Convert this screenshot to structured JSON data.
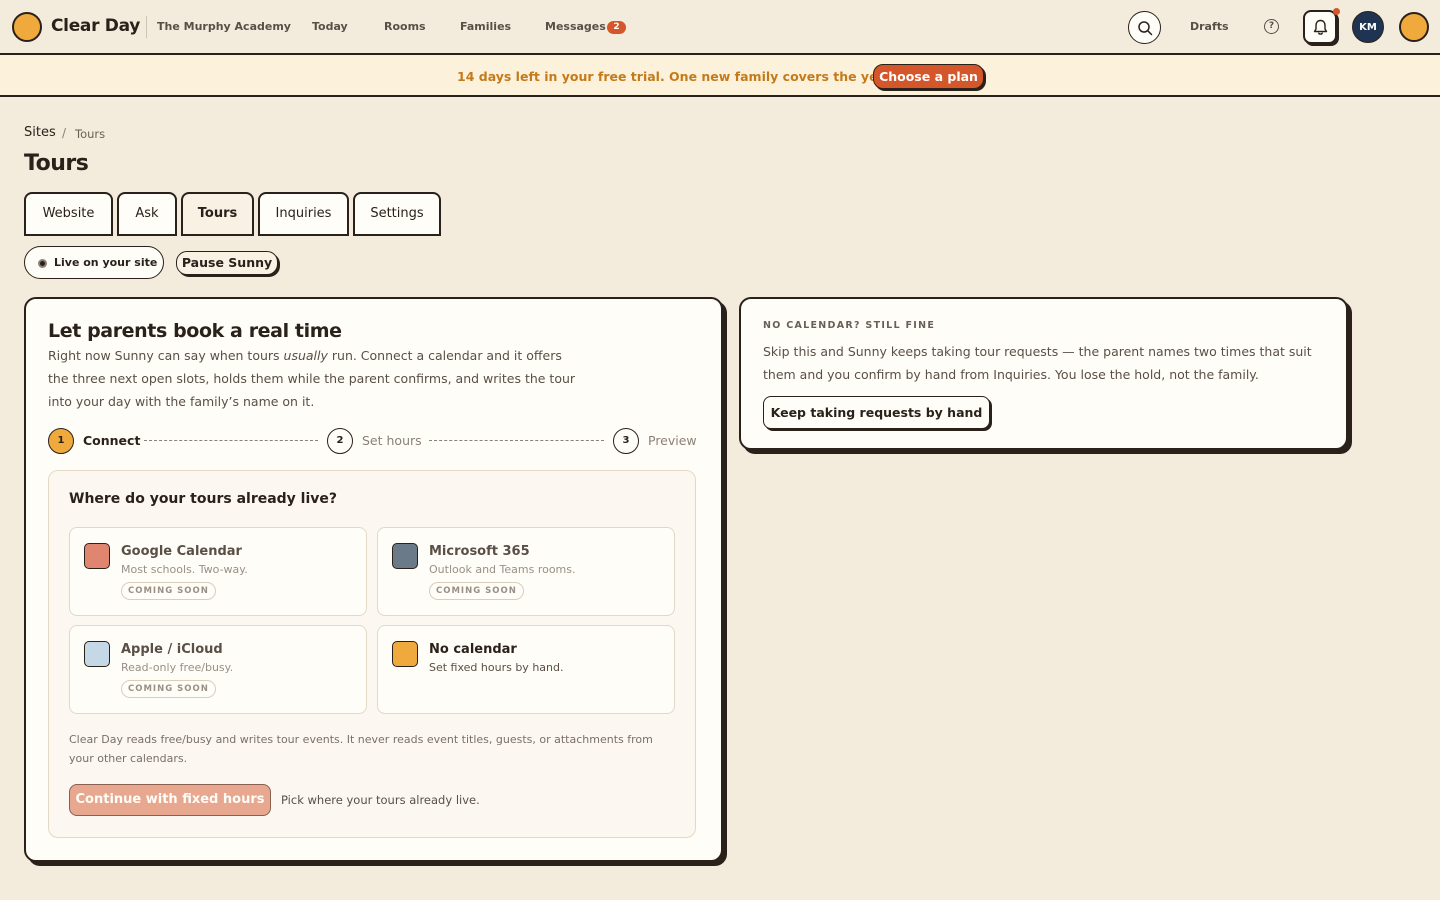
{
  "topnav": {
    "brand": "Clear Day",
    "school": "The Murphy Academy",
    "links": [
      "Today",
      "Rooms",
      "Families",
      "Messages"
    ],
    "messages_count": "2",
    "drafts": "Drafts",
    "help": "?",
    "avatar_initials": "KM"
  },
  "trial": {
    "text": "14 days left in your free trial. One new family covers the year.",
    "button": "Choose a plan"
  },
  "breadcrumb": {
    "root": "Sites",
    "separator": "/",
    "current": "Tours"
  },
  "page_title": "Tours",
  "tabs": [
    {
      "label": "Website"
    },
    {
      "label": "Ask"
    },
    {
      "label": "Tours"
    },
    {
      "label": "Inquiries"
    },
    {
      "label": "Settings"
    }
  ],
  "status": {
    "live_label": "Live on your site",
    "pause_label": "Pause Sunny"
  },
  "main_card": {
    "title": "Let parents book a real time",
    "desc_before": "Right now Sunny can say when tours ",
    "desc_emph": "usually",
    "desc_after": " run. Connect a calendar and it offers the three next open slots, holds them while the parent confirms, and writes the tour into your day with the family’s name on it.",
    "steps": [
      {
        "num": "1",
        "label": "Connect"
      },
      {
        "num": "2",
        "label": "Set hours"
      },
      {
        "num": "3",
        "label": "Preview"
      }
    ],
    "question": "Where do your tours already live?",
    "options": [
      {
        "name": "Google Calendar",
        "sub": "Most schools. Two-way.",
        "badge": "COMING SOON",
        "color": "#e08670"
      },
      {
        "name": "Microsoft 365",
        "sub": "Outlook and Teams rooms.",
        "badge": "COMING SOON",
        "color": "#6b7a88"
      },
      {
        "name": "Apple / iCloud",
        "sub": "Read-only free/busy.",
        "badge": "COMING SOON",
        "color": "#c4d8e6"
      },
      {
        "name": "No calendar",
        "sub": "Set fixed hours by hand.",
        "badge": "",
        "color": "#f0a93c"
      }
    ],
    "fine_print": "Clear Day reads free/busy and writes tour events. It never reads event titles, guests, or attachments from your other calendars.",
    "continue_label": "Continue with fixed hours",
    "continue_hint": "Pick where your tours already live."
  },
  "side_card": {
    "eyebrow": "NO CALENDAR? STILL FINE",
    "text": "Skip this and Sunny keeps taking tour requests — the parent names two times that suit them and you confirm by hand from Inquiries. You lose the hold, not the family.",
    "button": "Keep taking requests by hand"
  },
  "colors": {
    "background": "#f3ebdc",
    "accent": "#f0a93c",
    "cta": "#d4562b",
    "ink": "#2a211a"
  },
  "icons": [
    "logo-dot",
    "search-icon",
    "help-icon",
    "bell-icon",
    "user-dot"
  ]
}
